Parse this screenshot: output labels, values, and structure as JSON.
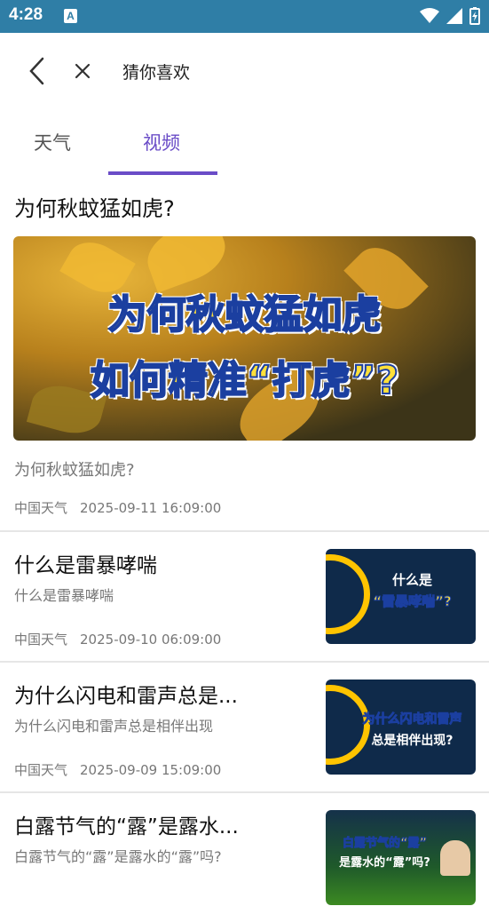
{
  "status": {
    "time": "4:28",
    "app_icon": "A"
  },
  "toolbar": {
    "title": "猜你喜欢"
  },
  "tabs": [
    {
      "label": "天气",
      "active": false
    },
    {
      "label": "视频",
      "active": true
    }
  ],
  "featured": {
    "title": "为何秋蚊猛如虎?",
    "thumb_line1": "为何秋蚊猛如虎",
    "thumb_line2": "如何精准“打虎”?",
    "subtitle": "为何秋蚊猛如虎?",
    "source": "中国天气",
    "date": "2025-09-11 16:09:00"
  },
  "items": [
    {
      "title": "什么是雷暴哮喘",
      "subtitle": "什么是雷暴哮喘",
      "source": "中国天气",
      "date": "2025-09-10 06:09:00",
      "thumb_line1": "什么是",
      "thumb_line2": "“雷暴哮喘”?"
    },
    {
      "title": "为什么闪电和雷声总是...",
      "subtitle": "为什么闪电和雷声总是相伴出现",
      "source": "中国天气",
      "date": "2025-09-09 15:09:00",
      "thumb_line1": "为什么闪电和雷声",
      "thumb_line2": "总是相伴出现?"
    },
    {
      "title": "白露节气的“露”是露水...",
      "subtitle": "白露节气的“露”是露水的“露”吗?",
      "thumb_line1": "白露节气的“露”",
      "thumb_line2": "是露水的“露”吗?"
    }
  ],
  "colors": {
    "status_bar": "#2f7ea6",
    "accent": "#6a4cc7"
  }
}
